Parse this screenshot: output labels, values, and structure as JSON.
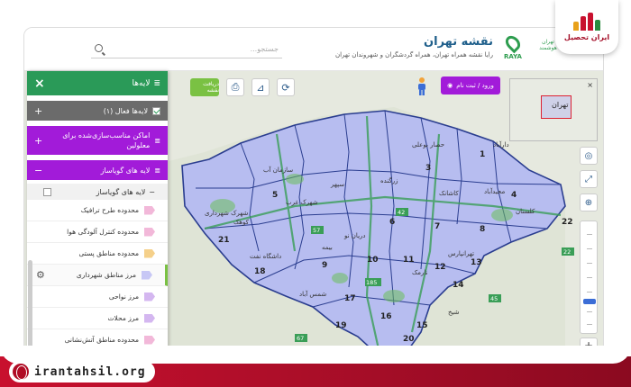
{
  "app": {
    "title": "نقشه تهران",
    "subtitle": "رایا نقشه همراه تهران، همراه گردشگران و شهروندان تهران",
    "search_placeholder": "جستجو...",
    "brand_raya": "RAYA",
    "brand_smartcity": "تهران هوشمند"
  },
  "badge": {
    "name": "ایران تحصیل"
  },
  "footer": {
    "url": "irantahsil.org"
  },
  "layers_panel": {
    "title": "لایه‌ها",
    "active_layers_label": "لایه‌ها فعال (۱)",
    "section1_label": "اماکن مناسب‌سازی‌شده برای معلولین",
    "section2_label": "لایه های گویاساز",
    "subgroup_label": "لایه های گویاساز",
    "items": [
      {
        "label": "محدوده طرح ترافیک",
        "color": "#f2b8d9"
      },
      {
        "label": "محدوده کنترل آلودگی هوا",
        "color": "#f2b8d9"
      },
      {
        "label": "محدوده مناطق پستی",
        "color": "#f5d08a"
      },
      {
        "label": "مرز مناطق شهرداری",
        "color": "#c7c7f5"
      },
      {
        "label": "مرز نواحی",
        "color": "#d4b7f0"
      },
      {
        "label": "مرز محلات",
        "color": "#d4b7f0"
      },
      {
        "label": "محدوده مناطق آتش‌نشانی",
        "color": "#f2b8d9"
      }
    ]
  },
  "toolbar": {
    "download_label": "دریافت نقشه",
    "login_label": "ورود / ثبت نام"
  },
  "minimap": {
    "label": "تهران",
    "close": "×"
  },
  "map": {
    "districts": [
      "1",
      "2",
      "3",
      "4",
      "5",
      "6",
      "7",
      "8",
      "9",
      "10",
      "11",
      "12",
      "13",
      "14",
      "15",
      "16",
      "17",
      "18",
      "19",
      "20",
      "21",
      "22"
    ],
    "place_labels": [
      "حصار بوعلی",
      "دارآباد",
      "زرگنده",
      "کاشانک",
      "مجیدآباد",
      "کلستان",
      "کوهک",
      "شهرک غرب",
      "شهرک شهرداری",
      "سپهر",
      "سازمان آب",
      "فرودگاه",
      "بیمه",
      "داشگاه نفت",
      "شمس آباد",
      "رباط کریم",
      "خلیج فارس",
      "دولت آباد",
      "امامزاده عبدالله",
      "فردوس",
      "پرند",
      "خاک سفید",
      "شهرک رسالت",
      "نیروی هوایی",
      "دریان نو",
      "تهرانسر",
      "سبلان",
      "شیخ",
      "عباس آباد",
      "تهرانپارس",
      "نارمک",
      "شمیران نو",
      "شهدا",
      "خزانه",
      "حکیمیه"
    ],
    "road_numbers": [
      "42",
      "57",
      "185",
      "45",
      "67",
      "71",
      "22"
    ]
  }
}
